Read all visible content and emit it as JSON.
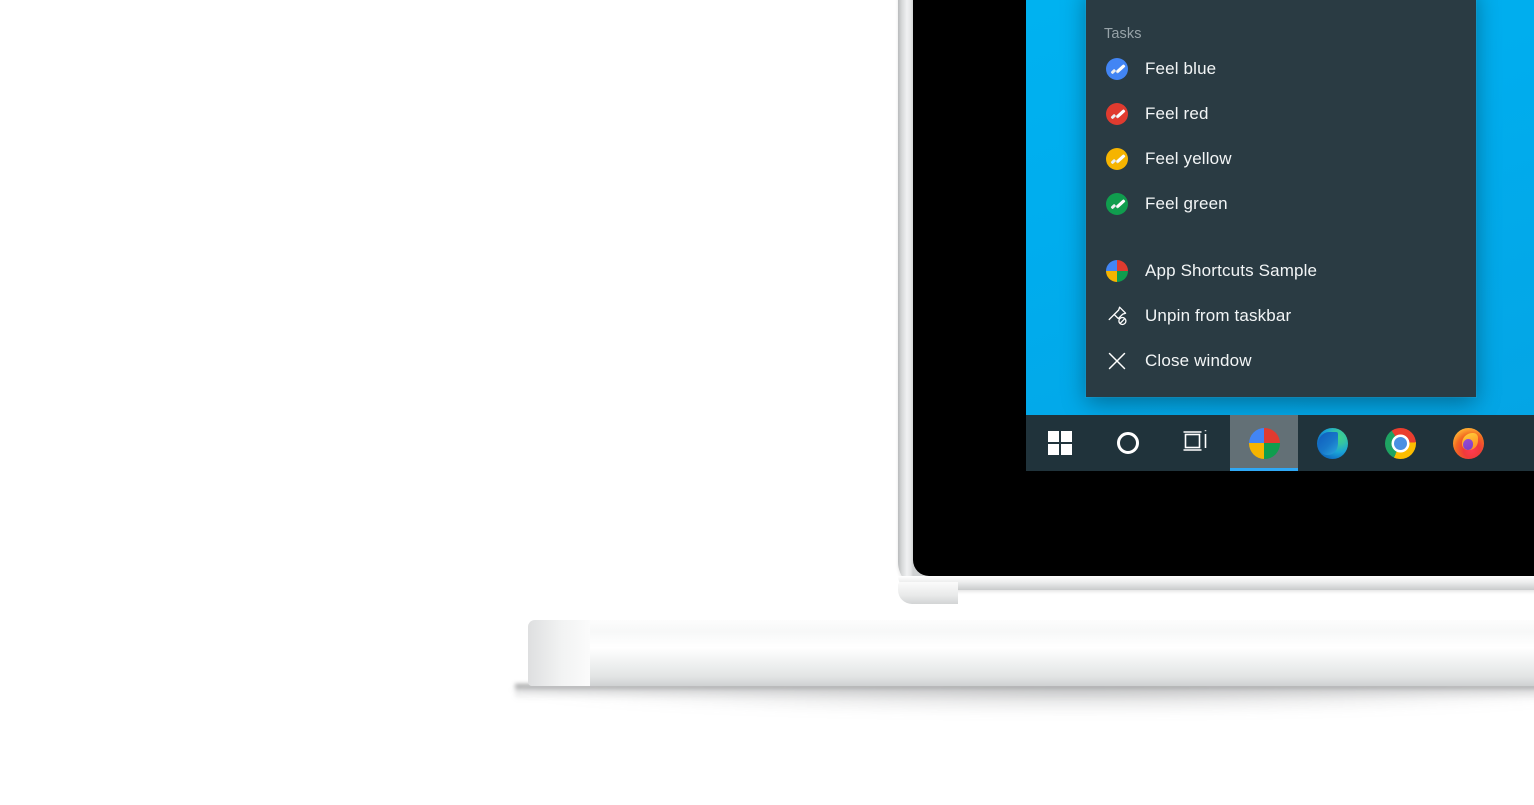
{
  "scene": {
    "device": "laptop",
    "description": "Windows 10 taskbar jump list open on a laptop screen"
  },
  "desktop": {
    "wallpaper_color": "#00adee"
  },
  "jumplist": {
    "background_color": "#2a3b43",
    "header": "Tasks",
    "header_color": "#97a3a8",
    "tasks": [
      {
        "label": "Feel blue",
        "icon": "paint-blue-icon",
        "color": "#4285f4"
      },
      {
        "label": "Feel red",
        "icon": "paint-red-icon",
        "color": "#e03b2f"
      },
      {
        "label": "Feel yellow",
        "icon": "paint-yellow-icon",
        "color": "#f6b400"
      },
      {
        "label": "Feel green",
        "icon": "paint-green-icon",
        "color": "#109d4e"
      }
    ],
    "actions": [
      {
        "label": "App Shortcuts Sample",
        "icon": "app-shortcuts-sample-icon"
      },
      {
        "label": "Unpin from taskbar",
        "icon": "unpin-icon"
      },
      {
        "label": "Close window",
        "icon": "close-icon"
      }
    ]
  },
  "taskbar": {
    "background_color": "#20333b",
    "active_indicator_color": "#2fa8f5",
    "items": [
      {
        "name": "start-button",
        "icon": "windows-logo-icon",
        "label": "Start",
        "active": false
      },
      {
        "name": "cortana-button",
        "icon": "cortana-circle-icon",
        "label": "Cortana",
        "active": false
      },
      {
        "name": "task-view-button",
        "icon": "task-view-icon",
        "label": "Task View",
        "active": false
      },
      {
        "name": "app-shortcuts-sample",
        "icon": "app-shortcuts-sample-icon",
        "label": "App Shortcuts Sample",
        "active": true
      },
      {
        "name": "microsoft-edge",
        "icon": "edge-icon",
        "label": "Microsoft Edge",
        "active": false
      },
      {
        "name": "google-chrome",
        "icon": "chrome-icon",
        "label": "Google Chrome",
        "active": false
      },
      {
        "name": "mozilla-firefox",
        "icon": "firefox-icon",
        "label": "Mozilla Firefox",
        "active": false
      }
    ]
  },
  "app_icon_quadrants": {
    "top_left": "#4285f4",
    "top_right": "#e03b2f",
    "bottom_left": "#f6b400",
    "bottom_right": "#109d4e"
  }
}
